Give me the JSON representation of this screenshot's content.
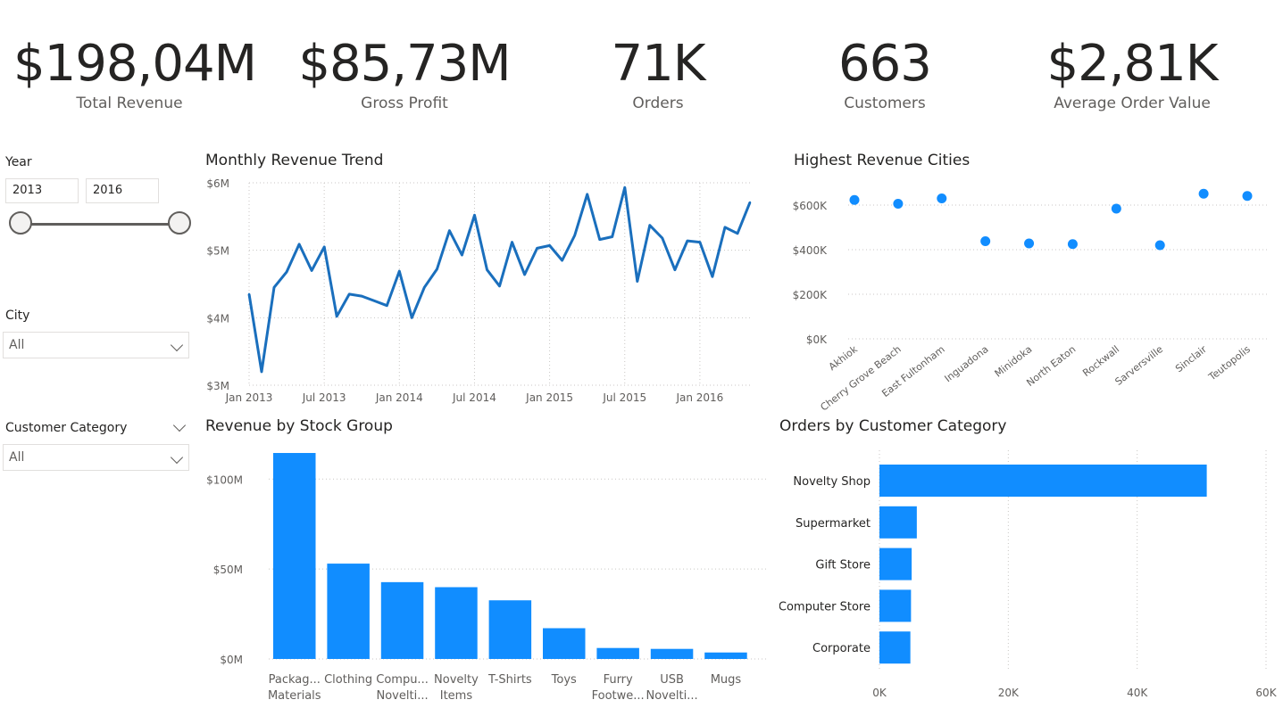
{
  "kpis": [
    {
      "value": "$198,04M",
      "label": "Total Revenue"
    },
    {
      "value": "$85,73M",
      "label": "Gross Profit"
    },
    {
      "value": "71K",
      "label": "Orders"
    },
    {
      "value": "663",
      "label": "Customers"
    },
    {
      "value": "$2,81K",
      "label": "Average Order Value"
    }
  ],
  "filters": {
    "year": {
      "title": "Year",
      "start": "2013",
      "end": "2016"
    },
    "city": {
      "title": "City",
      "value": "All"
    },
    "customer_category": {
      "title": "Customer Category",
      "value": "All"
    }
  },
  "colors": {
    "line": "#1a6fbd",
    "bar": "#118dff",
    "grid": "#c8c6c4",
    "axis_text": "#605e5c"
  },
  "chart_data": [
    {
      "type": "line",
      "title": "Monthly Revenue Trend",
      "x_tick_labels": [
        "Jan 2013",
        "Jul 2013",
        "Jan 2014",
        "Jul 2014",
        "Jan 2015",
        "Jul 2015",
        "Jan 2016"
      ],
      "y_tick_labels": [
        "$3M",
        "$4M",
        "$5M",
        "$6M"
      ],
      "ylim": [
        3,
        6
      ],
      "y_unit": "$M",
      "x": [
        "2013-01",
        "2013-02",
        "2013-03",
        "2013-04",
        "2013-05",
        "2013-06",
        "2013-07",
        "2013-08",
        "2013-09",
        "2013-10",
        "2013-11",
        "2013-12",
        "2014-01",
        "2014-02",
        "2014-03",
        "2014-04",
        "2014-05",
        "2014-06",
        "2014-07",
        "2014-08",
        "2014-09",
        "2014-10",
        "2014-11",
        "2014-12",
        "2015-01",
        "2015-02",
        "2015-03",
        "2015-04",
        "2015-05",
        "2015-06",
        "2015-07",
        "2015-08",
        "2015-09",
        "2015-10",
        "2015-11",
        "2015-12",
        "2016-01",
        "2016-02",
        "2016-03",
        "2016-04",
        "2016-05"
      ],
      "values": [
        4.35,
        3.2,
        4.45,
        4.68,
        5.09,
        4.7,
        5.05,
        4.02,
        4.35,
        4.32,
        4.25,
        4.18,
        4.69,
        4.0,
        4.45,
        4.72,
        5.29,
        4.93,
        5.52,
        4.71,
        4.47,
        5.12,
        4.64,
        5.03,
        5.07,
        4.85,
        5.22,
        5.83,
        5.16,
        5.2,
        5.93,
        4.54,
        5.37,
        5.18,
        4.71,
        5.14,
        5.12,
        4.61,
        5.34,
        5.25,
        5.71
      ],
      "grid": true
    },
    {
      "type": "scatter",
      "title": "Highest Revenue Cities",
      "categories": [
        "Akhiok",
        "Cherry Grove Beach",
        "East Fultonham",
        "Inguadona",
        "Minidoka",
        "North Eaton",
        "Rockwall",
        "Sarversville",
        "Sinclair",
        "Teutopolis"
      ],
      "values": [
        623,
        606,
        630,
        438,
        428,
        425,
        584,
        420,
        651,
        641
      ],
      "y_tick_labels": [
        "$0K",
        "$200K",
        "$400K",
        "$600K"
      ],
      "ylim": [
        0,
        700
      ],
      "y_unit": "$K",
      "grid": true
    },
    {
      "type": "bar",
      "title": "Revenue by Stock Group",
      "categories": [
        [
          "Packag...",
          "Materials"
        ],
        [
          "Clothing"
        ],
        [
          "Compu...",
          "Novelti..."
        ],
        [
          "Novelty",
          "Items"
        ],
        [
          "T-Shirts"
        ],
        [
          "Toys"
        ],
        [
          "Furry",
          "Footwe..."
        ],
        [
          "USB",
          "Novelti..."
        ],
        [
          "Mugs"
        ]
      ],
      "values": [
        114.5,
        53,
        42.7,
        39.9,
        32.6,
        17.1,
        6.1,
        5.6,
        3.6
      ],
      "y_tick_labels": [
        "$0M",
        "$50M",
        "$100M"
      ],
      "ylim": [
        0,
        115
      ],
      "y_unit": "$M",
      "grid": true
    },
    {
      "type": "bar",
      "orientation": "horizontal",
      "title": "Orders by Customer Category",
      "categories": [
        "Novelty Shop",
        "Supermarket",
        "Gift Store",
        "Computer Store",
        "Corporate"
      ],
      "values": [
        50800,
        5800,
        5000,
        4900,
        4800
      ],
      "x_tick_labels": [
        "0K",
        "20K",
        "40K",
        "60K"
      ],
      "xlim": [
        0,
        60000
      ],
      "grid": true
    }
  ]
}
